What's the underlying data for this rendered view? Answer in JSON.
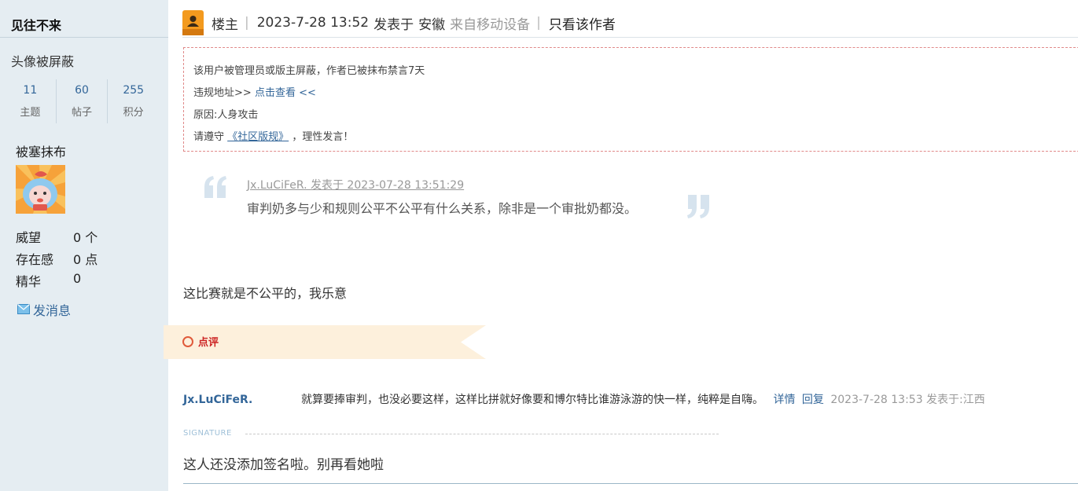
{
  "sidebar": {
    "username": "见往不来",
    "avatar_status": "头像被屏蔽",
    "stats": [
      {
        "value": "11",
        "label": "主题"
      },
      {
        "value": "60",
        "label": "帖子"
      },
      {
        "value": "255",
        "label": "积分"
      }
    ],
    "group": "被塞抹布",
    "details": [
      {
        "key": "威望",
        "value": "0 个"
      },
      {
        "key": "存在感",
        "value": "0 点"
      },
      {
        "key": "精华",
        "value": "0"
      }
    ],
    "message_label": "发消息",
    "message_icon": "envelope-icon"
  },
  "post": {
    "floor_label": "楼主",
    "posted_time": "2023-7-28 13:52",
    "posted_in_label": "发表于",
    "location": "安徽",
    "device": "来自移动设备",
    "author_only": "只看该作者",
    "floor_icon": "user-icon"
  },
  "ban": {
    "line1": "该用户被管理员或版主屏蔽，作者已被抹布禁言7天",
    "line2_prefix": "违规地址>>",
    "line2_link": "点击查看",
    "line2_suffix": "<<",
    "line3": "原因:人身攻击",
    "line4_prefix": "请遵守",
    "line4_link": "《社区版规》",
    "line4_suffix": "，理性发言！"
  },
  "quote": {
    "meta": "Jx.LuCiFeR. 发表于 2023-07-28 13:51:29",
    "text": "审判奶多与少和规则公平不公平有什么关系，除非是一个审批奶都没。"
  },
  "reply_text": "这比赛就是不公平的，我乐意",
  "comments_label": "点评",
  "comment": {
    "user": "Jx.LuCiFeR.",
    "text": "就算要捧审判，也没必要这样，这样比拼就好像要和博尔特比谁游泳游的快一样，纯粹是自嗨。",
    "detail_link": "详情",
    "reply_link": "回复",
    "time": "2023-7-28 13:53 发表于:江西"
  },
  "signature": {
    "label": "SIGNATURE",
    "text": "这人还没添加签名啦。别再看她啦"
  },
  "colors": {
    "sidebar_bg": "#e5edf2",
    "link": "#336699",
    "ribbon": "#fdf0dc",
    "comment_label": "#cc2222",
    "ban_border": "#e08989"
  }
}
